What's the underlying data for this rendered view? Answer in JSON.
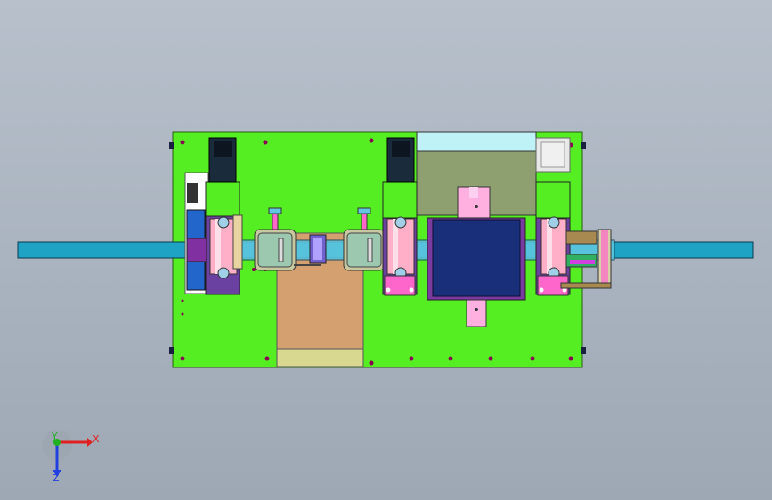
{
  "viewport": {
    "background": "#a9b3bf",
    "model": {
      "base_plate_color": "#55ee22",
      "belt_color": "#1ea3c4",
      "accent_pink": "#ff66cc",
      "motor_color": "#1a2b3c",
      "navy_block_color": "#1a2f7a"
    }
  },
  "triad": {
    "x_label": "X",
    "y_label": "Y",
    "z_label": "Z",
    "x_color": "#e02020",
    "y_color": "#20b020",
    "z_color": "#2040e0"
  }
}
